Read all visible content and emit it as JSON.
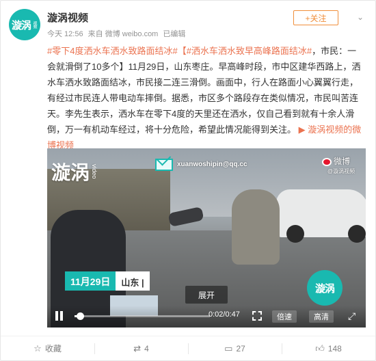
{
  "header": {
    "avatar_text": "漩涡",
    "avatar_sub": "视频",
    "author": "漩涡视频",
    "time": "今天 12:56",
    "source": "来自 微博 weibo.com",
    "edited": "已编辑",
    "follow_label": "+关注",
    "more_label": "⌄"
  },
  "post": {
    "topic1": "#零下4度洒水车洒水致路面结冰#",
    "topic2": "【#洒水车洒水致早高峰路面结冰#",
    "body": "，市民：一会就滑倒了10多个】11月29日，山东枣庄。早高峰时段，市中区建华西路上，洒水车洒水致路面结冰，市民接二连三滑倒。画面中，行人在路面小心翼翼行走，有经过市民连人带电动车摔倒。据悉，市区多个路段存在类似情况，市民叫苦连天。李先生表示，洒水车在零下4度的天里还在洒水，仅自己看到就有十余人滑倒，万一有机动车经过，将十分危险，希望此情况能得到关注。",
    "video_link": "漩涡视频的微博视频"
  },
  "video": {
    "watermark_left": "漩涡",
    "watermark_left_sub": "video",
    "email": "xuanwoshipin@qq.cc",
    "weibo_mark": "微博",
    "weibo_sub": "@漩涡视频",
    "date_label": "11月29日",
    "place_label": "山东 |",
    "watermark_right": "漩涡",
    "expand_label": "展开",
    "time": "0:02/0:47",
    "progress": 0.04,
    "speed_label": "倍速",
    "quality_label": "高清"
  },
  "footer": {
    "collect": "收藏",
    "repost": "4",
    "comment": "27",
    "like": "148"
  },
  "colors": {
    "accent": "#eb7350",
    "brand_teal": "#19b9b0",
    "follow_orange": "#f08e3a"
  }
}
